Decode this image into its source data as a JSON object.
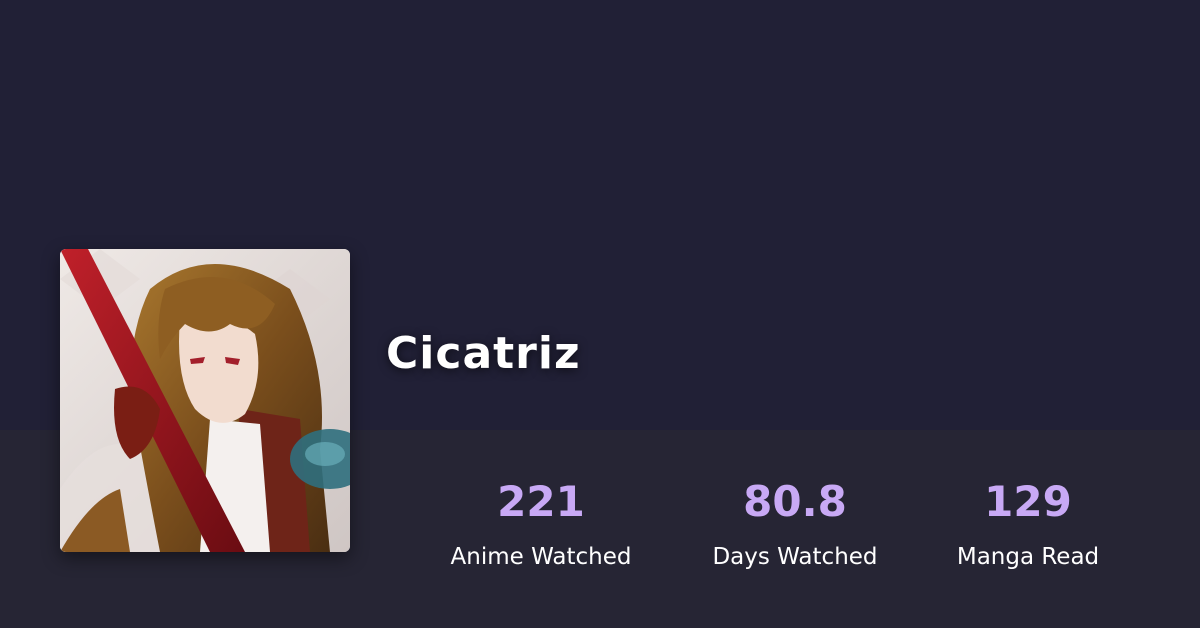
{
  "profile": {
    "username": "Cicatriz",
    "avatar_icon": "anime-character-avatar"
  },
  "stats": [
    {
      "value": "221",
      "label": "Anime Watched"
    },
    {
      "value": "80.8",
      "label": "Days Watched"
    },
    {
      "value": "129",
      "label": "Manga Read"
    }
  ],
  "colors": {
    "background": "#212036",
    "stats_bar": "#262534",
    "stat_value": "#c8a9f5",
    "text": "#ffffff"
  }
}
